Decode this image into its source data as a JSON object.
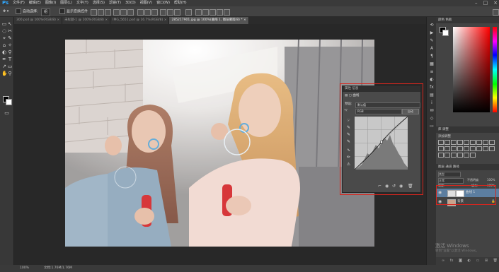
{
  "app": {
    "logo": "Ps"
  },
  "menu": {
    "items": [
      "文件(F)",
      "编辑(E)",
      "图像(I)",
      "图层(L)",
      "文字(Y)",
      "选择(S)",
      "滤镜(T)",
      "3D(D)",
      "视图(V)",
      "窗口(W)",
      "帮助(H)"
    ],
    "window_controls": [
      "–",
      "□",
      "×"
    ]
  },
  "options": {
    "auto_select_label": "自动选择:",
    "auto_select_value": "组",
    "transform_label": "显示变换控件"
  },
  "tabs": [
    "300.psd @ 100%(RGB/8)",
    "未标题-1 @ 100%(RGB/8)",
    "IMG_5651.psd @ 16.7%(RGB/8)",
    "285217901.jpg @ 100%(曲线 1, 图层蒙版/8) *"
  ],
  "tools": [
    "▭",
    "↖",
    "◌",
    "✂",
    "⌖",
    "✎",
    "⌂",
    "✧",
    "◐",
    "⚲",
    "✒",
    "T",
    "↗",
    "▭",
    "✋",
    "⚲"
  ],
  "curves": {
    "title_tabs": "属性   信息",
    "header_label": "曲线",
    "preset_label": "预设:",
    "preset_value": "默认值",
    "channel_value": "RGB",
    "auto_button": "自动"
  },
  "panels": {
    "color_tabs": "颜色   色板",
    "adjust_tabs": "库   调整",
    "adjust_label": "添加调整",
    "layers_tabs": "图层   通道   路径",
    "kind_label": "类型",
    "blend_mode": "正常",
    "opacity_label": "不透明度:",
    "opacity_value": "100%",
    "lock_label": "锁定:",
    "fill_label": "填充:",
    "fill_value": "100%",
    "layers": [
      {
        "name": "曲线 1",
        "has_mask": true
      },
      {
        "name": "背景",
        "has_mask": false
      }
    ]
  },
  "status": {
    "zoom": "100%",
    "doc": "文档:1.76M/1.76M"
  },
  "watermark": {
    "line1": "激活 Windows",
    "line2": "转到\"设置\"以激活 Windows。"
  }
}
